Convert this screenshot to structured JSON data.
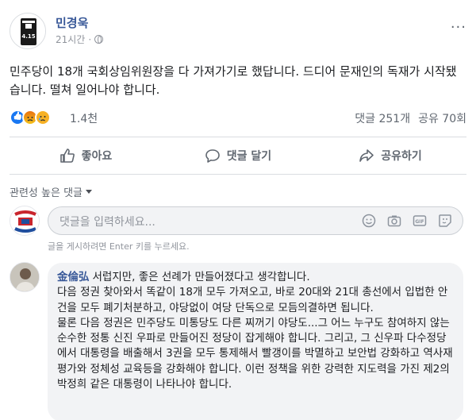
{
  "post": {
    "author": "민경욱",
    "time": "21시간",
    "text": "민주당이 18개 국회상임위원장을 다 가져가기로 했답니다. 드디어 문재인의 독재가 시작됐습니다. 떨쳐 일어나야 합니다.",
    "more_icon": "···"
  },
  "stats": {
    "reaction_count": "1.4천",
    "comments": "댓글 251개",
    "shares": "공유 70회"
  },
  "actions": {
    "like": "좋아요",
    "comment": "댓글 달기",
    "share": "공유하기"
  },
  "comments_section": {
    "filter_label": "관련성 높은 댓글",
    "input_placeholder": "댓글을 입력하세요...",
    "hint": "글을 게시하려면 Enter 키를 누르세요.",
    "profile_badge": "4.15"
  },
  "comment": {
    "author": "金倫弘",
    "text": "서럽지만, 좋은 선례가 만들어졌다고 생각합니다.\n다음 정권 찾아와서 똑같이 18개 모두 가져오고, 바로 20대와 21대 총선에서 입법한 안건을 모두 폐기처분하고, 야당없이 여당 단독으로 모듬의결하면 됩니다.\n물론 다음 정권은 민주당도 미통당도 다른 찌꺼기 야당도...그 어느 누구도 참여하지 않는 순수한 정통 신진 우파로 만들어진 정당이 잡게해야 합니다. 그리고, 그 신우파 다수정당에서 대통령을 배출해서 3권을 모두 통제해서 빨갱이를 박멸하고 보안법 강화하고 역사재평가와 정체성 교육등을 강화해야 합니다. 이런 정책을 위한 강력한 지도력을 가진 제2의 박정희 같은 대통령이 나타나야 합니다."
  }
}
